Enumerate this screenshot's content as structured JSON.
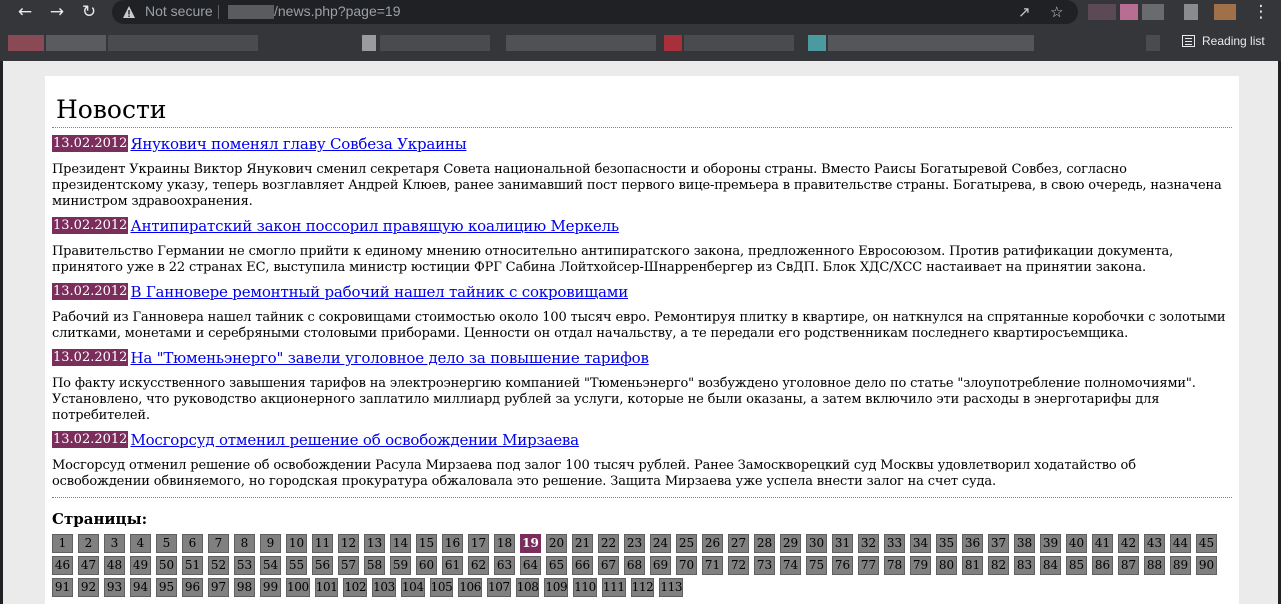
{
  "browser": {
    "security_label": "Not secure",
    "url_path": "/news.php?page=19",
    "reading_list_label": "Reading list",
    "icons": {
      "back": "back-arrow-icon",
      "forward": "forward-arrow-icon",
      "reload": "reload-icon",
      "warning": "warning-triangle-icon",
      "share": "share-icon",
      "star": "bookmark-star-icon",
      "menu": "kebab-menu-icon",
      "reading_list": "reading-list-icon"
    }
  },
  "page": {
    "heading": "Новости",
    "accent_color": "#7b2d5b",
    "news": [
      {
        "date": "13.02.2012",
        "title": "Янукович поменял главу Совбеза Украины",
        "text": "Президент Украины Виктор Янукович сменил секретаря Совета национальной безопасности и обороны страны. Вместо Раисы Богатыревой Совбез, согласно президентскому указу, теперь возглавляет Андрей Клюев, ранее занимавший пост первого вице-премьера в правительстве страны. Богатырева, в свою очередь, назначена министром здравоохранения."
      },
      {
        "date": "13.02.2012",
        "title": "Антипиратский закон поссорил правящую коалицию Меркель",
        "text": "Правительство Германии не смогло прийти к единому мнению относительно антипиратского закона, предложенного Евросоюзом. Против ратификации документа, принятого уже в 22 странах ЕС, выступила министр юстиции ФРГ Сабина Лойтхойсер-Шнарренбергер из СвДП. Блок ХДС/ХСС настаивает на принятии закона."
      },
      {
        "date": "13.02.2012",
        "title": "В Ганновере ремонтный рабочий нашел тайник с сокровищами",
        "text": "Рабочий из Ганновера нашел тайник с сокровищами стоимостью около 100 тысяч евро. Ремонтируя плитку в квартире, он наткнулся на спрятанные коробочки с золотыми слитками, монетами и серебряными столовыми приборами. Ценности он отдал начальству, а те передали его родственникам последнего квартиросъемщика."
      },
      {
        "date": "13.02.2012",
        "title": "На \"Тюменьэнерго\" завели уголовное дело за повышение тарифов",
        "text": "По факту искусственного завышения тарифов на электроэнергию компанией \"Тюменьэнерго\" возбуждено уголовное дело по статье \"злоупотребление полномочиями\". Установлено, что руководство акционерного заплатило миллиард рублей за услуги, которые не были оказаны, а затем включило эти расходы в энерготарифы для потребителей."
      },
      {
        "date": "13.02.2012",
        "title": "Мосгорсуд отменил решение об освобождении Мирзаева",
        "text": "Мосгорсуд отменил решение об освобождении Расула Мирзаева под залог 100 тысяч рублей. Ранее Замоскворецкий суд Москвы удовлетворил ходатайство об освобождении обвиняемого, но городская прокуратура обжаловала это решение. Защита Мирзаева уже успела внести залог на счет суда."
      }
    ],
    "pagination": {
      "label": "Страницы:",
      "current": 19,
      "pages": [
        "1",
        "2",
        "3",
        "4",
        "5",
        "6",
        "7",
        "8",
        "9",
        "10",
        "11",
        "12",
        "13",
        "14",
        "15",
        "16",
        "17",
        "18",
        "19",
        "20",
        "21",
        "22",
        "23",
        "24",
        "25",
        "26",
        "27",
        "28",
        "29",
        "30",
        "31",
        "32",
        "33",
        "34",
        "35",
        "36",
        "37",
        "38",
        "39",
        "40",
        "41",
        "42",
        "43",
        "44",
        "45",
        "46",
        "47",
        "48",
        "49",
        "50",
        "51",
        "52",
        "53",
        "54",
        "55",
        "56",
        "57",
        "58",
        "59",
        "60",
        "61",
        "62",
        "63",
        "64",
        "65",
        "66",
        "67",
        "68",
        "69",
        "70",
        "71",
        "72",
        "73",
        "74",
        "75",
        "76",
        "77",
        "78",
        "79",
        "80",
        "81",
        "82",
        "83",
        "84",
        "85",
        "86",
        "87",
        "88",
        "89",
        "90",
        "91",
        "92",
        "93",
        "94",
        "95",
        "96",
        "97",
        "98",
        "99",
        "100",
        "101",
        "102",
        "103",
        "104",
        "105",
        "106",
        "107",
        "108",
        "109",
        "110",
        "111",
        "112",
        "113"
      ]
    }
  }
}
